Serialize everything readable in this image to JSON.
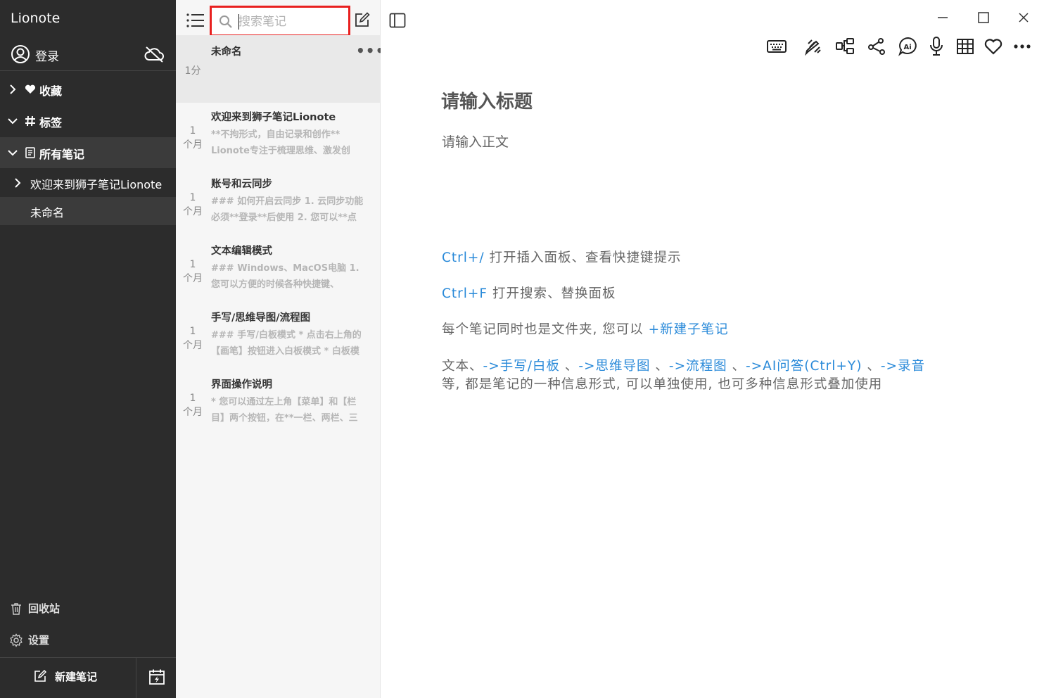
{
  "sidebar": {
    "app_title": "Lionote",
    "login_label": "登录",
    "nav": {
      "favorites": "收藏",
      "tags": "标签",
      "all_notes": "所有笔记"
    },
    "tree": [
      {
        "label": "欢迎来到狮子笔记Lionote"
      },
      {
        "label": "未命名"
      }
    ],
    "trash": "回收站",
    "settings": "设置",
    "new_note": "新建笔记"
  },
  "list": {
    "search_placeholder": "搜索笔记",
    "notes": [
      {
        "title": "未命名",
        "time_a": "1分",
        "time_b": "",
        "snippet_1": "",
        "snippet_2": ""
      },
      {
        "title": "欢迎来到狮子笔记Lionote",
        "time_a": "1",
        "time_b": "个月",
        "snippet_1": "   **不拘形式，自由记录和创作**",
        "snippet_2": "Lionote专注于梳理思维、激发创"
      },
      {
        "title": "账号和云同步",
        "time_a": "1",
        "time_b": "个月",
        "snippet_1": "### 如何开启云同步  1. 云同步功能",
        "snippet_2": "必须**登录**后使用  2. 您可以**点"
      },
      {
        "title": "文本编辑模式",
        "time_a": "1",
        "time_b": "个月",
        "snippet_1": "### Windows、MacOS电脑  1.",
        "snippet_2": "您可以方便的时候各种快捷键、"
      },
      {
        "title": "手写/思维导图/流程图",
        "time_a": "1",
        "time_b": "个月",
        "snippet_1": "### 手写/白板模式  * 点击右上角的",
        "snippet_2": "【画笔】按钮进入白板模式  * 白板模"
      },
      {
        "title": "界面操作说明",
        "time_a": "1",
        "time_b": "个月",
        "snippet_1": " * 您可以通过左上角【菜单】和【栏",
        "snippet_2": "目】两个按钮，在**一栏、两栏、三"
      }
    ]
  },
  "editor": {
    "title_placeholder": "请输入标题",
    "body_placeholder": "请输入正文",
    "hint1_key": "Ctrl+/",
    "hint1_text": " 打开插入面板、查看快捷键提示",
    "hint2_key": "Ctrl+F",
    "hint2_text": " 打开搜索、替换面板",
    "hint3_text": "每个笔记同时也是文件夹, 您可以 ",
    "hint3_link": "+新建子笔记",
    "hint4_pre": "文本、",
    "hint4_l1": "->手写/白板",
    "hint4_s1": " 、",
    "hint4_l2": "->思维导图",
    "hint4_s2": " 、",
    "hint4_l3": "->流程图",
    "hint4_s3": " 、",
    "hint4_l4": "->AI问答(Ctrl+Y)",
    "hint4_s4": " 、",
    "hint4_l5": "->录音",
    "hint5_text": "等,  都是笔记的一种信息形式,  可以单独使用,  也可多种信息形式叠加使用"
  },
  "colors": {
    "sidebar_bg": "#2c2c2c",
    "accent_blue": "#2a8ad9",
    "highlight_red": "#e8201f"
  }
}
